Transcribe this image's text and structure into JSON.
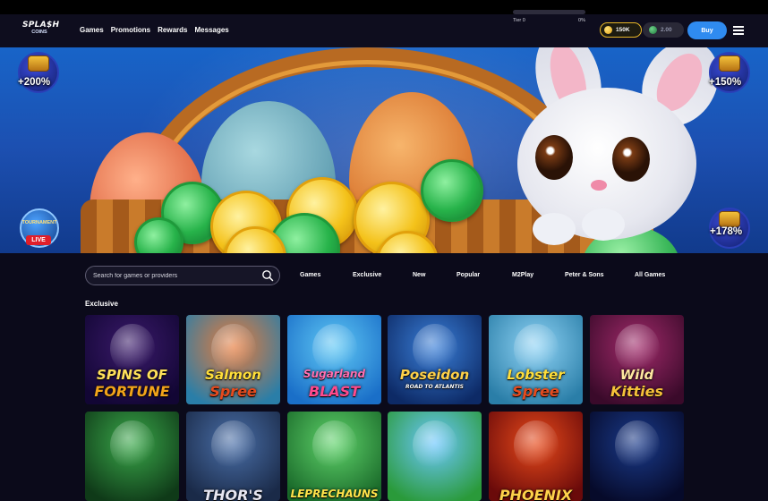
{
  "brand": {
    "line1": "SPLA$H",
    "line2": "COINS"
  },
  "nav": {
    "items": [
      "Games",
      "Promotions",
      "Rewards",
      "Messages"
    ]
  },
  "tier": {
    "label": "Tier 0",
    "percent_label": "0%",
    "progress": 0
  },
  "balance": {
    "gold": "150K",
    "sweeps": "2.00"
  },
  "buttons": {
    "buy": "Buy"
  },
  "hero": {
    "badges": {
      "top_left": "+200%",
      "top_right": "+150%",
      "bottom_right": "+178%"
    },
    "tournament": {
      "label": "TOURNAMENT",
      "live": "LIVE"
    },
    "coin_mark": "GC",
    "sc_mark": "SC"
  },
  "search": {
    "placeholder": "Search for games or providers"
  },
  "categories": [
    "Games",
    "Exclusive",
    "New",
    "Popular",
    "M2Play",
    "Peter & Sons",
    "All Games"
  ],
  "section": {
    "title": "Exclusive"
  },
  "games": [
    {
      "line1": "SPINS OF",
      "line2": "FORTUNE",
      "bg1": "#3a1a6a",
      "bg2": "#120634",
      "c1": "#ffe15a",
      "c2": "#f2a41a"
    },
    {
      "line1": "Salmon",
      "line2": "Spree",
      "bg1": "#e87a3a",
      "bg2": "#2a7ea8",
      "c1": "#ffde3a",
      "c2": "#e64b1e"
    },
    {
      "line1": "Sugarland",
      "line2": "BLAST",
      "bg1": "#5fc8f5",
      "bg2": "#1a6fc8",
      "c1": "#ff6fb2",
      "c2": "#ff4a8c"
    },
    {
      "line1": "Poseidon",
      "line2": "ROAD TO ATLANTIS",
      "bg1": "#3a7fd8",
      "bg2": "#0d2a66",
      "c1": "#ffd24a",
      "c2": "#ffffff"
    },
    {
      "line1": "Lobster",
      "line2": "Spree",
      "bg1": "#8fd3f5",
      "bg2": "#2a7ea8",
      "c1": "#ffde3a",
      "c2": "#e64b1e"
    },
    {
      "line1": "Wild",
      "line2": "Kitties",
      "bg1": "#a12a6a",
      "bg2": "#3a0a2a",
      "c1": "#ffe8a0",
      "c2": "#f6c23a"
    },
    {
      "line1": "",
      "line2": "",
      "bg1": "#3aa84a",
      "bg2": "#0f3a18",
      "c1": "#ffffff",
      "c2": "#ffffff"
    },
    {
      "line1": "",
      "line2": "THOR'S",
      "bg1": "#4a6fa8",
      "bg2": "#1a2a48",
      "c1": "#ffffff",
      "c2": "#e7e7f2"
    },
    {
      "line1": "",
      "line2": "LEPRECHAUNS",
      "bg1": "#5fd36a",
      "bg2": "#1a6a2a",
      "c1": "#ffffff",
      "c2": "#ffe24a"
    },
    {
      "line1": "",
      "line2": "",
      "bg1": "#6cc7ff",
      "bg2": "#2a9a3a",
      "c1": "#ffffff",
      "c2": "#ffffff"
    },
    {
      "line1": "",
      "line2": "PHOENIX",
      "bg1": "#e84a1a",
      "bg2": "#6a0a0a",
      "c1": "#ffffff",
      "c2": "#ffd24a"
    },
    {
      "line1": "",
      "line2": "",
      "bg1": "#1a3a8a",
      "bg2": "#060a2a",
      "c1": "#ffffff",
      "c2": "#ffd24a"
    }
  ]
}
